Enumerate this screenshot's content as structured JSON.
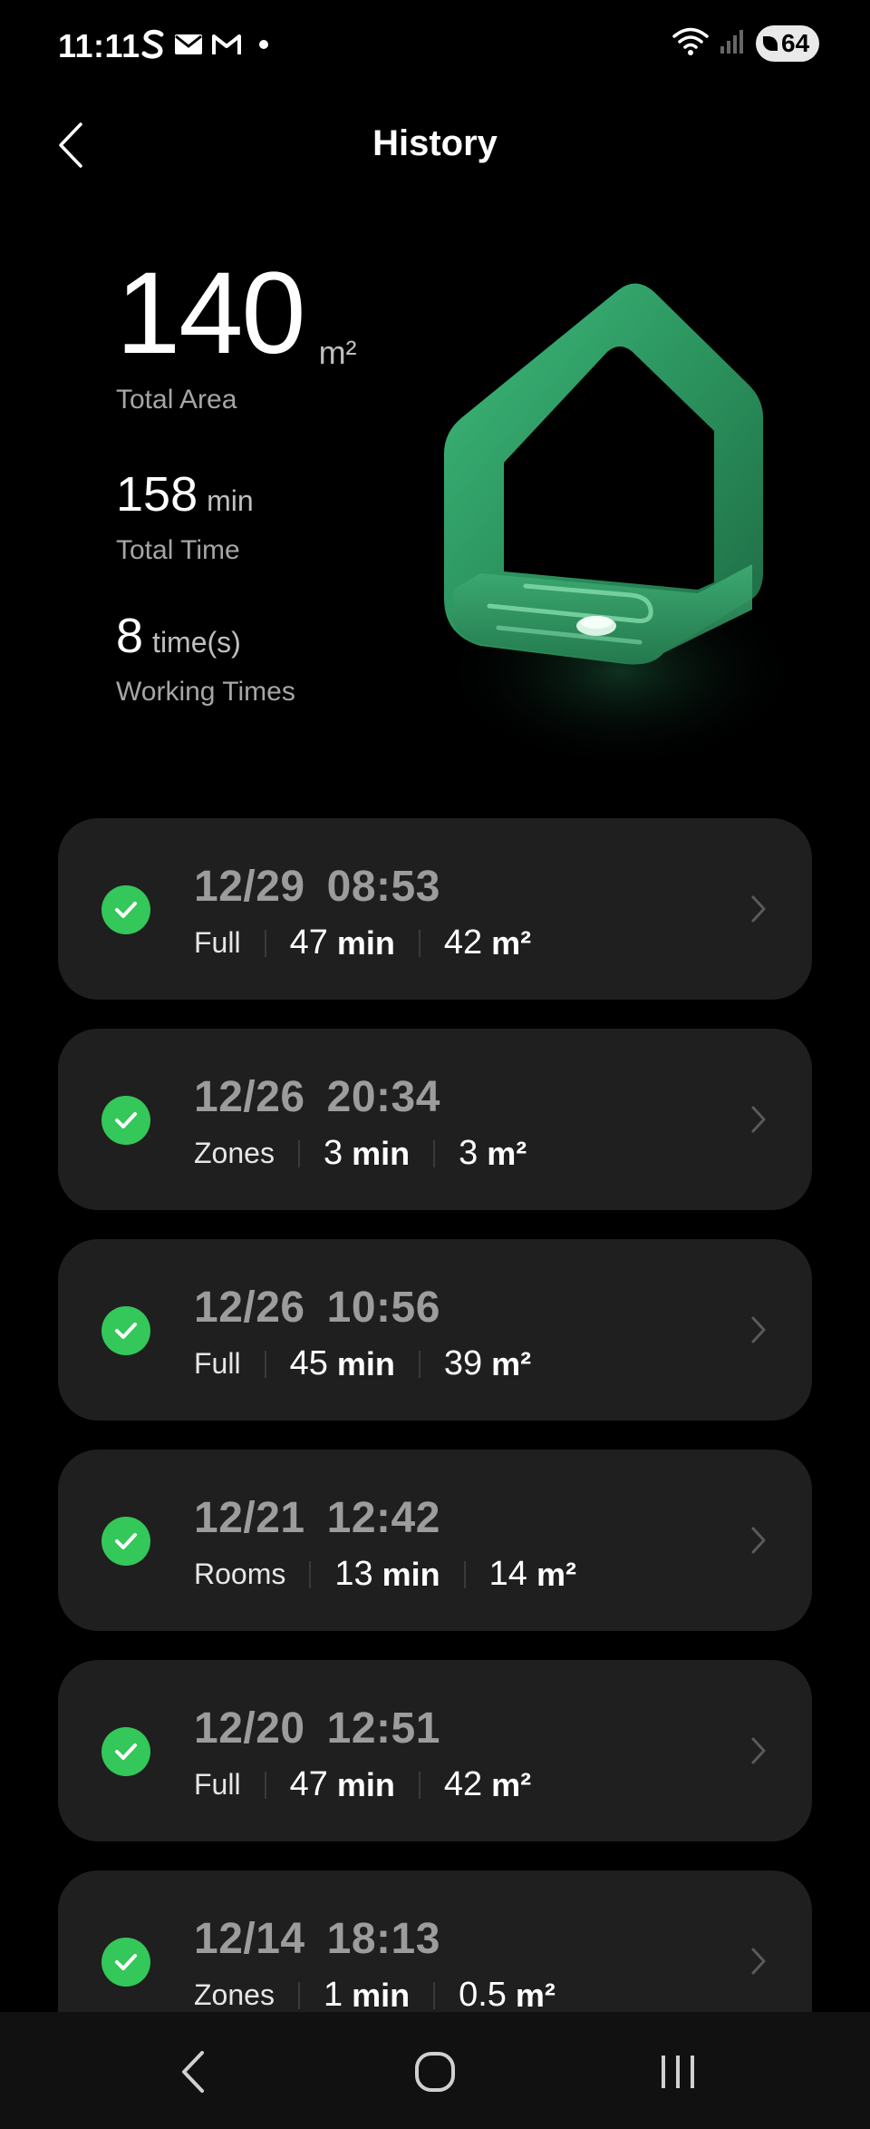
{
  "status_bar": {
    "time": "11:11",
    "battery": "64",
    "icons": [
      "s-app-icon",
      "mail-icon",
      "gmail-icon",
      "notification-dot",
      "wifi-icon",
      "signal-icon",
      "battery-icon"
    ]
  },
  "header": {
    "title": "History",
    "back_icon": "chevron-left-icon"
  },
  "summary": {
    "total_area_value": "140",
    "total_area_unit": "m²",
    "total_area_label": "Total Area",
    "total_time_value": "158",
    "total_time_unit": "min",
    "total_time_label": "Total Time",
    "working_times_value": "8",
    "working_times_unit": "time(s)",
    "working_times_label": "Working Times"
  },
  "records": [
    {
      "date": "12/29",
      "time": "08:53",
      "mode": "Full",
      "duration": "47",
      "duration_unit": "min",
      "area": "42",
      "area_unit": "m²"
    },
    {
      "date": "12/26",
      "time": "20:34",
      "mode": "Zones",
      "duration": "3",
      "duration_unit": "min",
      "area": "3",
      "area_unit": "m²"
    },
    {
      "date": "12/26",
      "time": "10:56",
      "mode": "Full",
      "duration": "45",
      "duration_unit": "min",
      "area": "39",
      "area_unit": "m²"
    },
    {
      "date": "12/21",
      "time": "12:42",
      "mode": "Rooms",
      "duration": "13",
      "duration_unit": "min",
      "area": "14",
      "area_unit": "m²"
    },
    {
      "date": "12/20",
      "time": "12:51",
      "mode": "Full",
      "duration": "47",
      "duration_unit": "min",
      "area": "42",
      "area_unit": "m²"
    },
    {
      "date": "12/14",
      "time": "18:13",
      "mode": "Zones",
      "duration": "1",
      "duration_unit": "min",
      "area": "0.5",
      "area_unit": "m²"
    }
  ],
  "colors": {
    "background": "#000000",
    "card": "#1f1f1f",
    "success": "#34c759",
    "house_green": "#2e9a62",
    "muted_text": "#9c9c9c"
  },
  "nav_bar": {
    "icons": [
      "nav-back-icon",
      "nav-home-icon",
      "nav-recents-icon"
    ]
  }
}
